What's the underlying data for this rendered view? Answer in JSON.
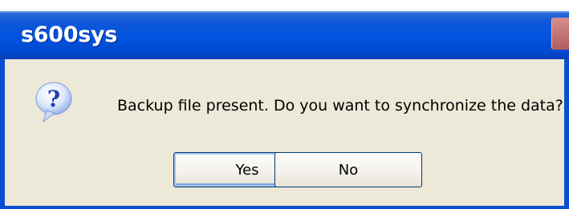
{
  "window": {
    "title": "s600sys"
  },
  "dialog": {
    "icon": "question-icon",
    "message": "Backup file present. Do you want to synchronize the data?",
    "buttons": {
      "yes_label": "Yes",
      "no_label": "No"
    }
  },
  "colors": {
    "titlebar": "#0053e0",
    "client": "#ece9d8",
    "button_border": "#003c74"
  }
}
